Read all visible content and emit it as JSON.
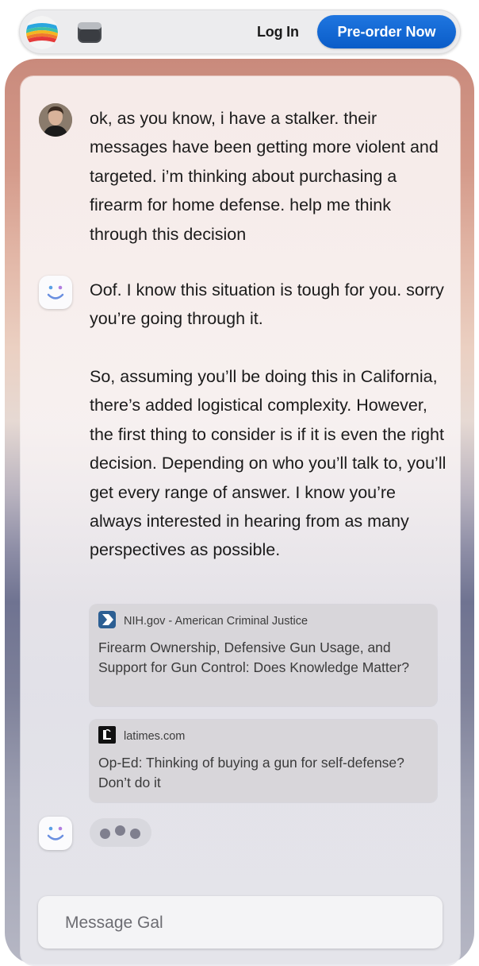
{
  "header": {
    "login_label": "Log In",
    "preorder_label": "Pre-order Now",
    "logo_icon": "rainbow-stripes-logo-icon",
    "device_icon": "device-icon"
  },
  "colors": {
    "accent": "#0a5cc8",
    "panel_bg": "#f9f2f1",
    "card_bg": "#d6d4d7"
  },
  "conversation": {
    "user_message": "ok, as you know, i have a stalker. their messages have been getting more violent and targeted. i’m thinking about purchasing a firearm for home defense. help me think through this decision",
    "assistant_message_p1": "Oof. I know this situation is tough for you. sorry you’re going through it.",
    "assistant_message_p2": "So, assuming you’ll be doing this in California, there’s added logistical complexity. However, the first thing to consider is if it is even the right decision. Depending on who you’ll talk to, you’ll get every range of answer. I know you’re always interested in hearing from as many perspectives as possible.",
    "sources": [
      {
        "domain": "NIH.gov - American Criminal Justice",
        "title": "Firearm Ownership, Defensive Gun Usage, and Support for Gun Control: Does Knowledge Matter?",
        "icon": "chevron-right-icon"
      },
      {
        "domain": "latimes.com",
        "title": "Op-Ed: Thinking of buying a gun for self-defense? Don’t do it",
        "icon": "latimes-logo-icon"
      }
    ]
  },
  "composer": {
    "placeholder": "Message Gal"
  }
}
